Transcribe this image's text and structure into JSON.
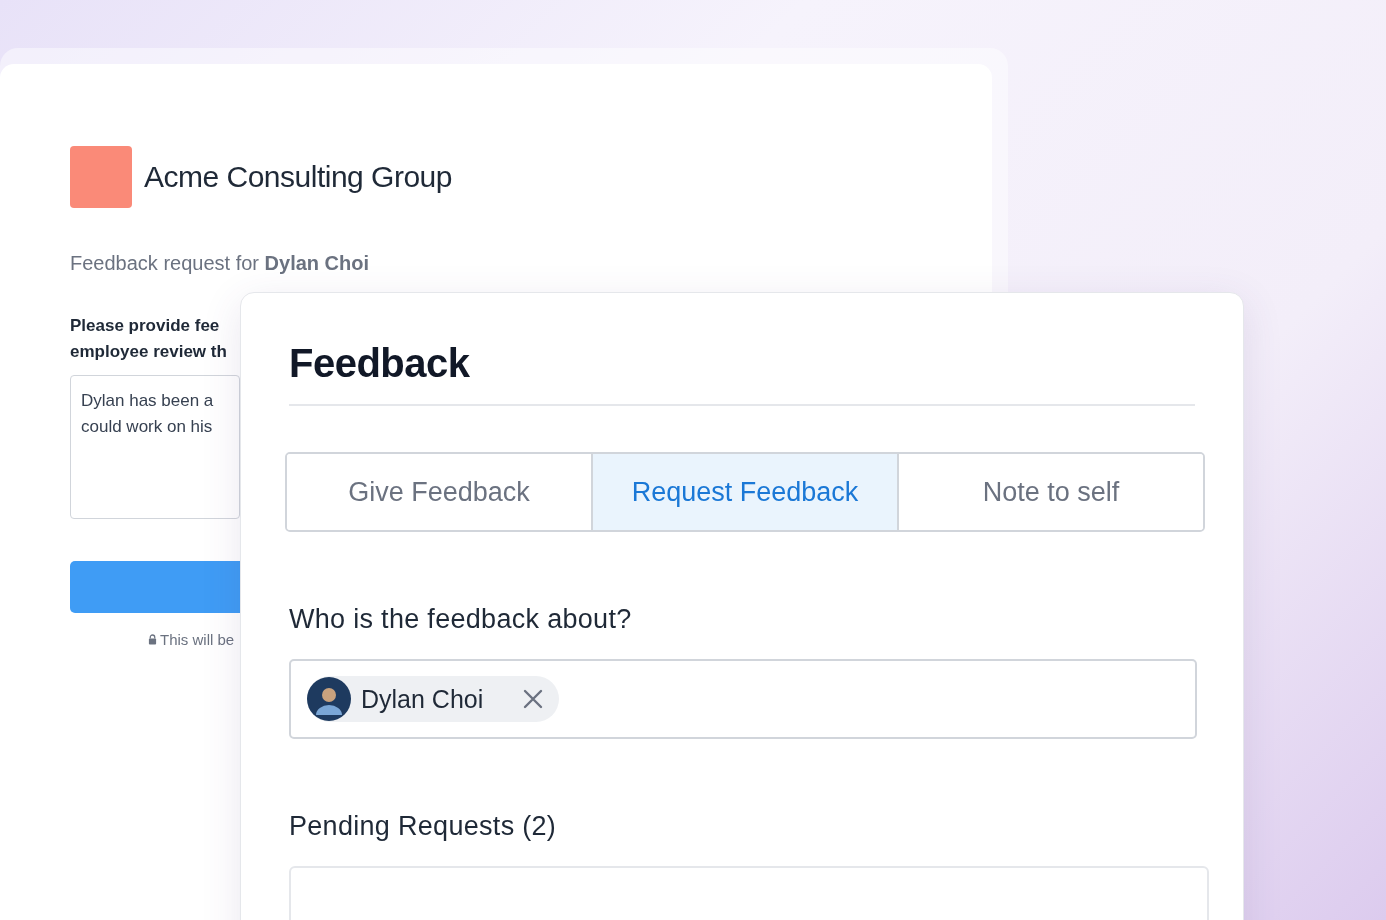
{
  "back_form": {
    "company": "Acme Consulting Group",
    "request_label": "Feedback request for **Dylan Choi**",
    "prompt_lines": [
      "Please provide fee",
      "employee review th"
    ],
    "answer_lines": [
      "Dylan has been a",
      "could work on his"
    ],
    "privacy_note": "This will be"
  },
  "feedback_panel": {
    "title": "Feedback",
    "tabs": [
      {
        "label": "Give Feedback",
        "selected": false
      },
      {
        "label": "Request Feedback",
        "selected": true
      },
      {
        "label": "Note to self",
        "selected": false
      }
    ],
    "about_label": "Who is the feedback about?",
    "recipients": [
      {
        "name": "Dylan Choi"
      }
    ],
    "pending_label": "Pending Requests (2)"
  }
}
